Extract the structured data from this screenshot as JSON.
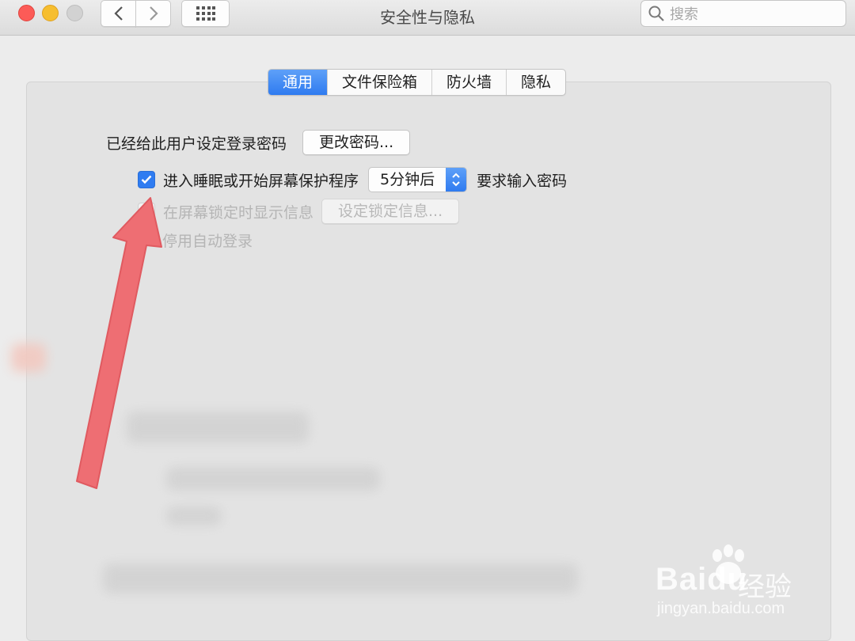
{
  "window": {
    "title": "安全性与隐私",
    "search_placeholder": "搜索"
  },
  "tabs": [
    {
      "label": "通用",
      "active": true
    },
    {
      "label": "文件保险箱",
      "active": false
    },
    {
      "label": "防火墙",
      "active": false
    },
    {
      "label": "隐私",
      "active": false
    }
  ],
  "general": {
    "password_set_label": "已经给此用户设定登录密码",
    "change_password_button": "更改密码...",
    "require_password_label": "进入睡眠或开始屏幕保护程序",
    "require_password_checked": true,
    "require_password_delay": "5分钟后",
    "require_password_suffix": "要求输入密码",
    "lock_message_label": "在屏幕锁定时显示信息",
    "lock_message_checked": false,
    "lock_message_button": "设定锁定信息...",
    "disable_auto_login_label": "停用自动登录"
  },
  "watermark": {
    "brand": "Baidu",
    "brand_cn": "经验",
    "url": "jingyan.baidu.com"
  },
  "colors": {
    "accent": "#2f7bf0",
    "arrow": "#ee6e73"
  }
}
